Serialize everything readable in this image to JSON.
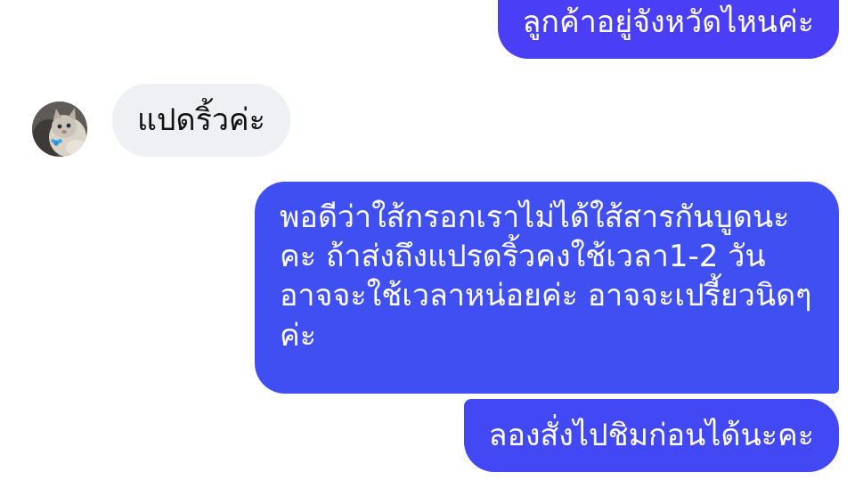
{
  "messages": [
    {
      "side": "outgoing",
      "text": "ลูกค้าอยู่จังหวัดไหนค่ะ"
    },
    {
      "side": "incoming",
      "text": "แปดริ้วค่ะ"
    },
    {
      "side": "outgoing",
      "text": "พอดีว่าใส้กรอกเราไม่ได้ใส้สารกันบูดนะคะ ถ้าส่งถึงแปรดริ้วคงใช้เวลา1-2 วันอาจจะใช้เวลาหน่อยค่ะ อาจจะเปรี้ยวนิดๆค่ะ"
    },
    {
      "side": "outgoing",
      "text": "ลองสั่งไปชิมก่อนได้นะคะ"
    }
  ],
  "colors": {
    "outgoing_bubble": "#4a3ff6",
    "incoming_bubble": "#eff0f3",
    "outgoing_text": "#ffffff",
    "incoming_text": "#111111"
  },
  "icons": {
    "avatar": "cat-avatar-icon"
  }
}
